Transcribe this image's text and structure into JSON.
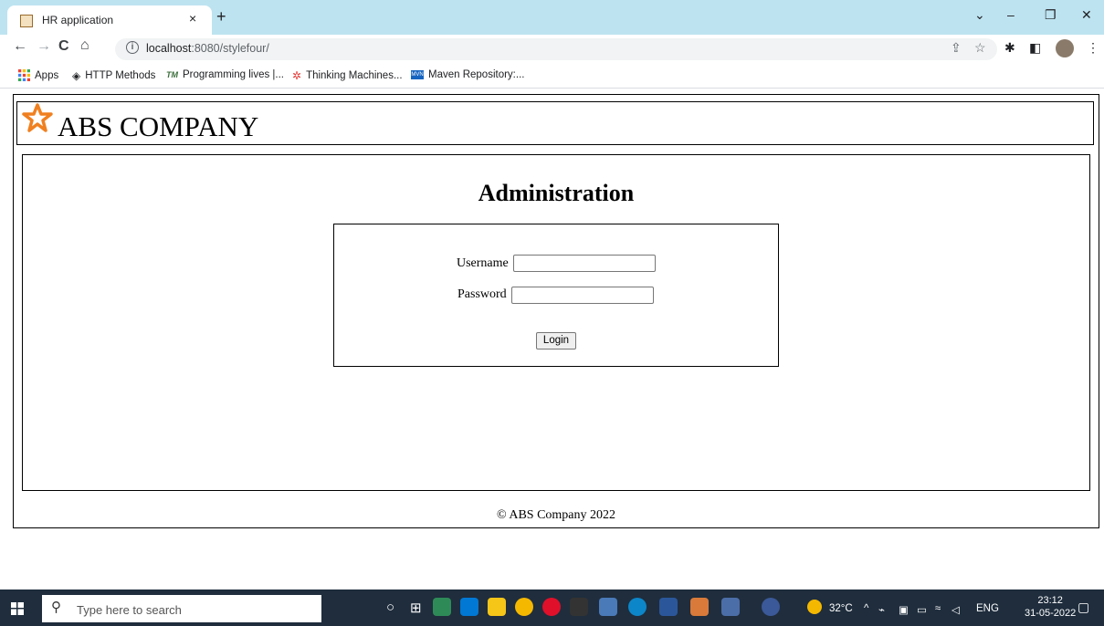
{
  "browser": {
    "tab_title": "HR application",
    "tab_close": "×",
    "new_tab": "+",
    "url_host": "localhost",
    "url_path": ":8080/stylefour/",
    "info": "i",
    "win_min": "–",
    "win_restore": "❐",
    "win_close": "✕",
    "tab_search": "⌄",
    "bookmarks": [
      {
        "label": "Apps"
      },
      {
        "label": "HTTP Methods"
      },
      {
        "label": "Programming lives |..."
      },
      {
        "label": "Thinking Machines..."
      },
      {
        "label": "Maven Repository:..."
      }
    ]
  },
  "page": {
    "company_name": "ABS COMPANY",
    "title": "Administration",
    "username_label": "Username",
    "username_value": "",
    "password_label": "Password",
    "password_value": "",
    "login_label": "Login",
    "footer": "© ABS Company 2022",
    "star_color": "#f08020"
  },
  "taskbar": {
    "search_placeholder": "Type here to search",
    "temperature": "32°C",
    "language": "ENG",
    "time": "23:12",
    "date": "31-05-2022"
  }
}
